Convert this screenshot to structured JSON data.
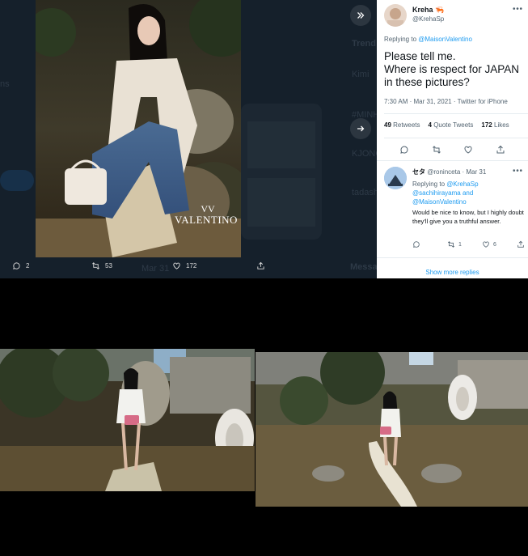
{
  "left_column": {
    "faint_tokens": [
      "ns",
      "Trend",
      "Kimi",
      "#MINH",
      "KJONG",
      "tadashi",
      "Messages"
    ]
  },
  "media": {
    "brand_logo_text": "VALENTINO",
    "actions": {
      "replies": "2",
      "retweets": "53",
      "likes": "172"
    },
    "faint_timestamp": "Mar 31"
  },
  "tweet": {
    "display_name": "Kreha",
    "name_emoji": "🦐",
    "handle": "@KrehaSp",
    "replying_to_label": "Replying to",
    "replying_to_handle": "@MaisonValentino",
    "body_line1": "Please tell me.",
    "body_line2": "Where is respect for JAPAN",
    "body_line3": "in these pictures?",
    "meta": "7:30 AM · Mar 31, 2021 · Twitter for iPhone",
    "retweets_count": "49",
    "retweets_label": "Retweets",
    "quotes_count": "4",
    "quotes_label": "Quote Tweets",
    "likes_count": "172",
    "likes_label": "Likes"
  },
  "reply": {
    "display_name": "セタ",
    "handle": "@roninceta",
    "date": "Mar 31",
    "replying_to_label": "Replying to",
    "mention1": "@KrehaSp",
    "mention2": "@sachihirayama",
    "and_label": "and",
    "mention3": "@MaisonValentino",
    "text": "Would be nice to know, but I highly doubt they'll give you a truthful answer.",
    "retweets": "1",
    "likes": "6"
  },
  "show_more_replies": "Show more replies",
  "colors": {
    "dark_bg": "#15202b",
    "accent": "#1d9bf0",
    "panel_bg": "#ffffff"
  }
}
